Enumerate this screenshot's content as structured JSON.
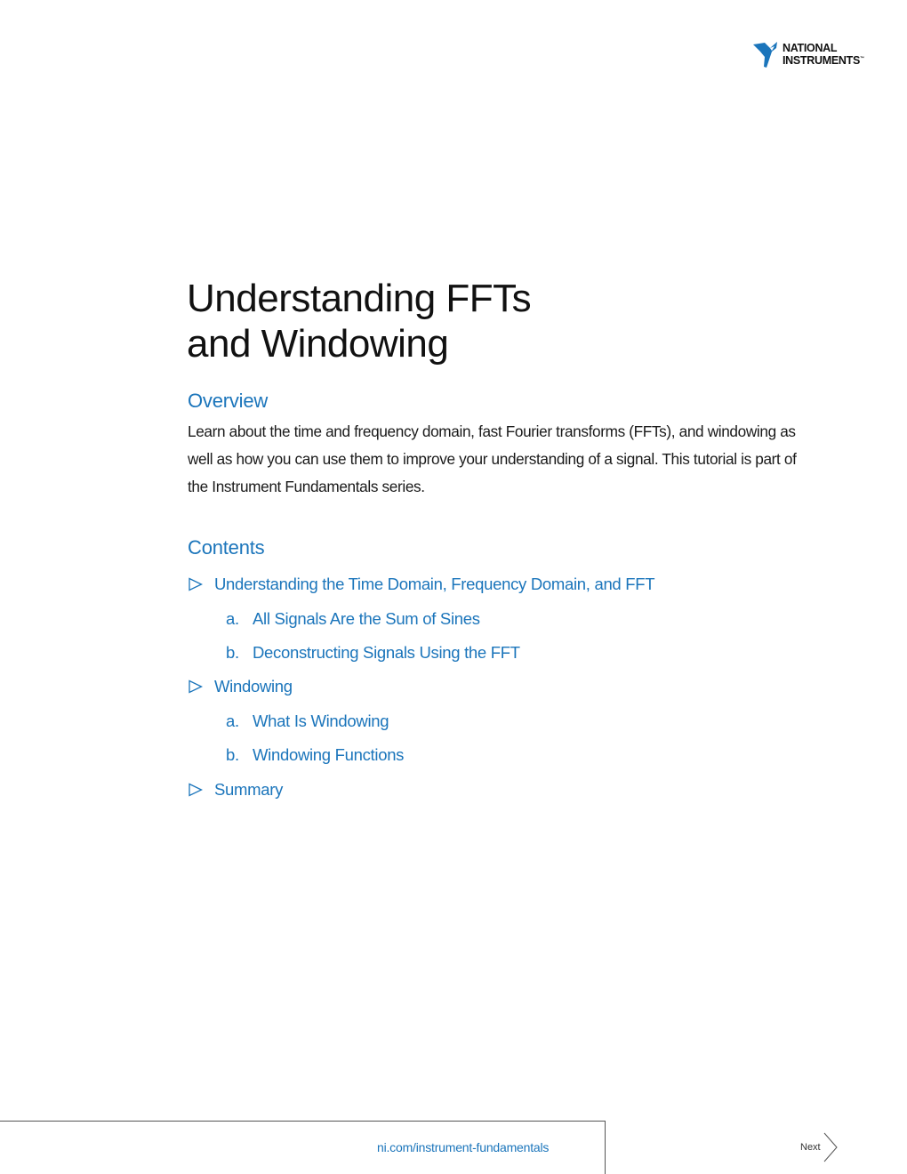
{
  "brand": {
    "name_line1": "NATIONAL",
    "name_line2": "INSTRUMENTS",
    "trademark": "™",
    "logo_color": "#1b75bb"
  },
  "document": {
    "title_line1": "Understanding FFTs",
    "title_line2": "and Windowing"
  },
  "overview": {
    "heading": "Overview",
    "body": "Learn about the time and frequency domain, fast Fourier transforms (FFTs), and windowing as well as how you can use them to improve your understanding of a signal. This tutorial is part of the Instrument Fundamentals series."
  },
  "contents": {
    "heading": "Contents",
    "items": [
      {
        "type": "section",
        "label": "Understanding the Time Domain, Frequency Domain, and FFT",
        "icon": "triangle-right-outline-icon"
      },
      {
        "type": "sub",
        "letter": "a.",
        "label": "All Signals Are the Sum of Sines"
      },
      {
        "type": "sub",
        "letter": "b.",
        "label": "Deconstructing Signals Using the FFT"
      },
      {
        "type": "section",
        "label": "Windowing",
        "icon": "triangle-right-outline-icon"
      },
      {
        "type": "sub",
        "letter": "a.",
        "label": "What Is Windowing"
      },
      {
        "type": "sub",
        "letter": "b.",
        "label": "Windowing Functions"
      },
      {
        "type": "section",
        "label": "Summary",
        "icon": "triangle-right-outline-icon"
      }
    ]
  },
  "footer": {
    "link_text": "ni.com/instrument-fundamentals",
    "next_label": "Next",
    "next_icon": "chevron-right-icon"
  },
  "colors": {
    "accent": "#1b75bb",
    "text": "#1a1a1a"
  }
}
